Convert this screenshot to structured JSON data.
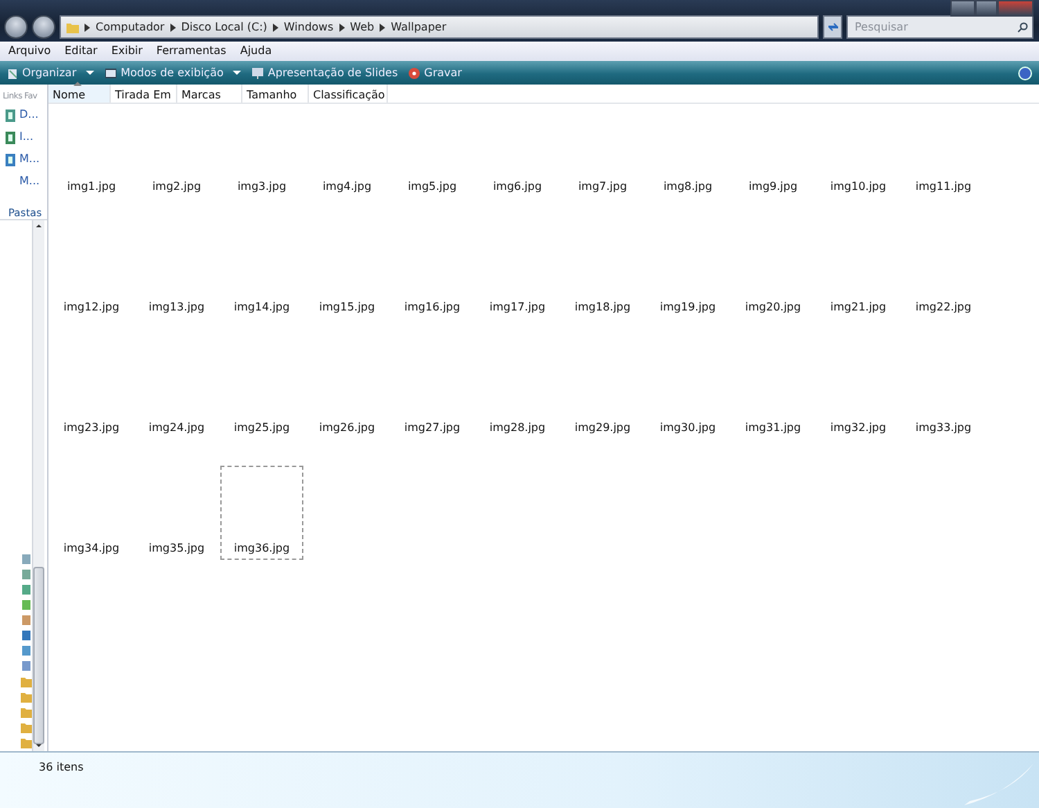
{
  "address_bar": {
    "crumbs": [
      "Computador",
      "Disco Local (C:)",
      "Windows",
      "Web",
      "Wallpaper"
    ]
  },
  "search": {
    "placeholder": "Pesquisar"
  },
  "menu": [
    "Arquivo",
    "Editar",
    "Exibir",
    "Ferramentas",
    "Ajuda"
  ],
  "toolbar": [
    {
      "label": "Organizar",
      "kind": "dropdown"
    },
    {
      "label": "Modos de exibição",
      "kind": "dropdown"
    },
    {
      "label": "Apresentação de Slides",
      "kind": "button"
    },
    {
      "label": "Gravar",
      "kind": "button"
    }
  ],
  "columns": [
    {
      "label": "Nome",
      "sorted": true
    },
    {
      "label": "Tirada Em",
      "sorted": false
    },
    {
      "label": "Marcas",
      "sorted": false
    },
    {
      "label": "Tamanho",
      "sorted": false
    },
    {
      "label": "Classificação",
      "sorted": false
    }
  ],
  "nav_pane": {
    "header": "Links Fav",
    "links": [
      "D...",
      "I...",
      "M...",
      "M..."
    ],
    "folders_label": "Pastas"
  },
  "files": [
    {
      "name": "img1.jpg",
      "focused": false
    },
    {
      "name": "img2.jpg",
      "focused": false
    },
    {
      "name": "img3.jpg",
      "focused": false
    },
    {
      "name": "img4.jpg",
      "focused": false
    },
    {
      "name": "img5.jpg",
      "focused": false
    },
    {
      "name": "img6.jpg",
      "focused": false
    },
    {
      "name": "img7.jpg",
      "focused": false
    },
    {
      "name": "img8.jpg",
      "focused": false
    },
    {
      "name": "img9.jpg",
      "focused": false
    },
    {
      "name": "img10.jpg",
      "focused": false
    },
    {
      "name": "img11.jpg",
      "focused": false
    },
    {
      "name": "img12.jpg",
      "focused": false
    },
    {
      "name": "img13.jpg",
      "focused": false
    },
    {
      "name": "img14.jpg",
      "focused": false
    },
    {
      "name": "img15.jpg",
      "focused": false
    },
    {
      "name": "img16.jpg",
      "focused": false
    },
    {
      "name": "img17.jpg",
      "focused": false
    },
    {
      "name": "img18.jpg",
      "focused": false
    },
    {
      "name": "img19.jpg",
      "focused": false
    },
    {
      "name": "img20.jpg",
      "focused": false
    },
    {
      "name": "img21.jpg",
      "focused": false
    },
    {
      "name": "img22.jpg",
      "focused": false
    },
    {
      "name": "img23.jpg",
      "focused": false
    },
    {
      "name": "img24.jpg",
      "focused": false
    },
    {
      "name": "img25.jpg",
      "focused": false
    },
    {
      "name": "img26.jpg",
      "focused": false
    },
    {
      "name": "img27.jpg",
      "focused": false
    },
    {
      "name": "img28.jpg",
      "focused": false
    },
    {
      "name": "img29.jpg",
      "focused": false
    },
    {
      "name": "img30.jpg",
      "focused": false
    },
    {
      "name": "img31.jpg",
      "focused": false
    },
    {
      "name": "img32.jpg",
      "focused": false
    },
    {
      "name": "img33.jpg",
      "focused": false
    },
    {
      "name": "img34.jpg",
      "focused": false
    },
    {
      "name": "img35.jpg",
      "focused": false
    },
    {
      "name": "img36.jpg",
      "focused": true
    }
  ],
  "status_bar": {
    "count": "36 itens"
  }
}
